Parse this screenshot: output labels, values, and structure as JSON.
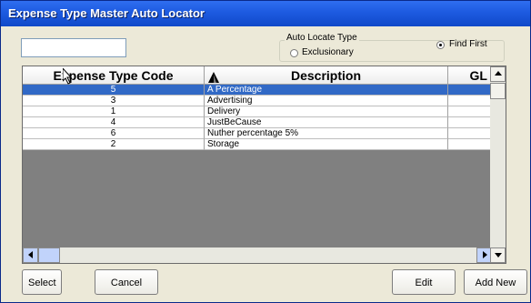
{
  "window": {
    "title": "Expense Type Master Auto Locator"
  },
  "search": {
    "value": ""
  },
  "auto_locate": {
    "group_label": "Auto Locate Type",
    "options": [
      {
        "label": "Exclusionary",
        "checked": false
      },
      {
        "label": "Find First",
        "checked": true
      }
    ]
  },
  "grid": {
    "columns": [
      "Expense Type Code",
      "Description",
      "GL"
    ],
    "rows": [
      {
        "code": "5",
        "description": "A Percentage",
        "gl": "",
        "selected": true
      },
      {
        "code": "3",
        "description": "Advertising",
        "gl": "",
        "selected": false
      },
      {
        "code": "1",
        "description": "Delivery",
        "gl": "",
        "selected": false
      },
      {
        "code": "4",
        "description": "JustBeCause",
        "gl": "",
        "selected": false
      },
      {
        "code": "6",
        "description": "Nuther percentage 5%",
        "gl": "",
        "selected": false
      },
      {
        "code": "2",
        "description": "Storage",
        "gl": "",
        "selected": false
      }
    ]
  },
  "buttons": {
    "select": "Select",
    "cancel": "Cancel",
    "edit": "Edit",
    "add_new": "Add New"
  }
}
